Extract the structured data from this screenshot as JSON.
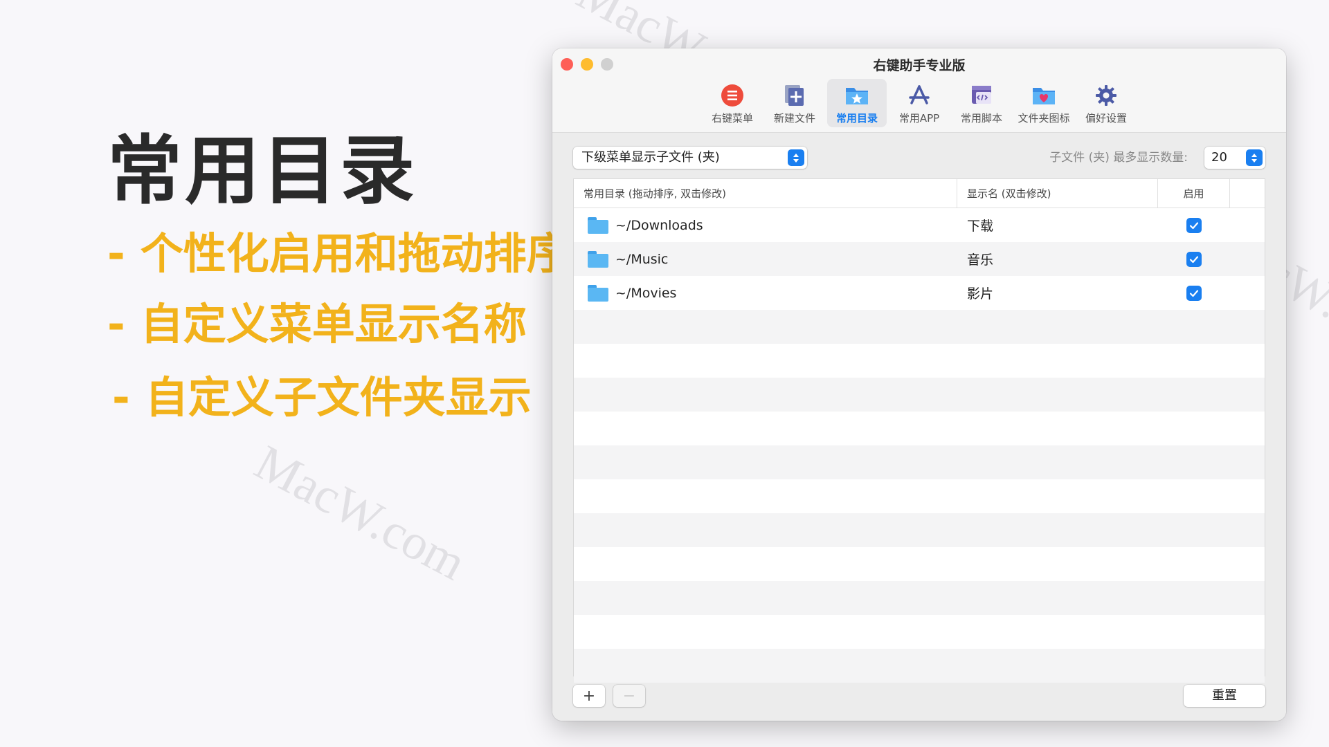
{
  "slide": {
    "headline": "常用目录",
    "bullets": [
      "个性化启用和拖动排序",
      "自定义菜单显示名称",
      "自定义子文件夹显示"
    ],
    "dash": "-",
    "watermark": "MacW.com",
    "accent_color": "#f2b21b"
  },
  "window": {
    "title": "右键助手专业版",
    "toolbar": [
      {
        "label": "右键菜单",
        "icon": "menu-list-icon"
      },
      {
        "label": "新建文件",
        "icon": "new-file-icon"
      },
      {
        "label": "常用目录",
        "icon": "folder-star-icon",
        "active": true
      },
      {
        "label": "常用APP",
        "icon": "app-store-icon"
      },
      {
        "label": "常用脚本",
        "icon": "script-icon"
      },
      {
        "label": "文件夹图标",
        "icon": "folder-heart-icon"
      },
      {
        "label": "偏好设置",
        "icon": "gear-icon"
      }
    ],
    "submenu_select": "下级菜单显示子文件 (夹)",
    "max_count_label": "子文件 (夹) 最多显示数量:",
    "max_count_value": "20",
    "table": {
      "headers": [
        "常用目录 (拖动排序, 双击修改)",
        "显示名 (双击修改)",
        "启用"
      ],
      "rows": [
        {
          "path": "~/Downloads",
          "name": "下载",
          "enabled": true
        },
        {
          "path": "~/Music",
          "name": "音乐",
          "enabled": true
        },
        {
          "path": "~/Movies",
          "name": "影片",
          "enabled": true
        }
      ]
    },
    "add_label": "+",
    "remove_label": "−",
    "reset_label": "重置",
    "accent_color": "#1a7ff0"
  }
}
